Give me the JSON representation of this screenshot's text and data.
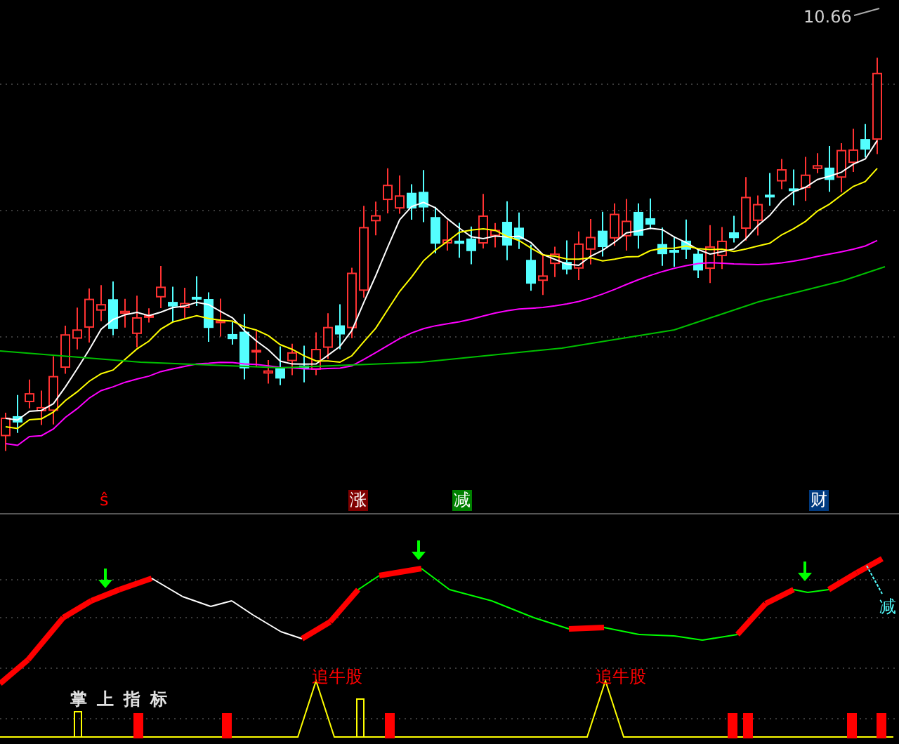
{
  "price_panel": {
    "price_label": "10.66"
  },
  "signal_row": [
    {
      "text": "ŝ",
      "kind": "plain",
      "color": "#ff0000"
    },
    {
      "text": "涨",
      "kind": "badge",
      "color": "#800000"
    },
    {
      "text": "减",
      "kind": "badge",
      "color": "#008000"
    },
    {
      "text": "财",
      "kind": "badge",
      "color": "#003a80"
    }
  ],
  "indicator_panel": {
    "title": "掌上指标",
    "signals": [
      {
        "text": "追牛股"
      },
      {
        "text": "追牛股"
      }
    ],
    "end_label": "减"
  }
}
